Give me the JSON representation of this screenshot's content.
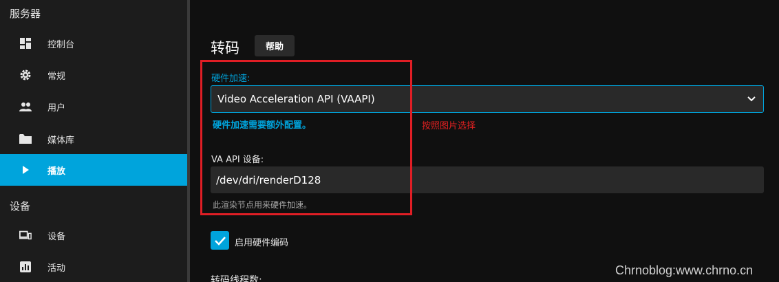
{
  "sidebar": {
    "section_server": "服务器",
    "section_devices": "设备",
    "items": [
      {
        "label": "控制台",
        "icon": "dashboard-icon"
      },
      {
        "label": "常规",
        "icon": "gear-icon"
      },
      {
        "label": "用户",
        "icon": "people-icon"
      },
      {
        "label": "媒体库",
        "icon": "folder-icon"
      },
      {
        "label": "播放",
        "icon": "play-icon",
        "active": true
      },
      {
        "label": "设备",
        "icon": "devices-icon"
      },
      {
        "label": "活动",
        "icon": "activity-chart-icon"
      }
    ]
  },
  "main": {
    "title": "转码",
    "help_button": "帮助",
    "hw_accel_label": "硬件加速:",
    "hw_accel_value": "Video Acceleration API (VAAPI)",
    "hw_accel_note": "硬件加速需要额外配置。",
    "annotation": "按照图片选择",
    "vaapi_device_label": "VA API 设备:",
    "vaapi_device_value": "/dev/dri/renderD128",
    "vaapi_device_hint": "此渲染节点用来硬件加速。",
    "hw_encoding_label": "启用硬件编码",
    "hw_encoding_checked": true,
    "transcode_threads_label": "转码线程数:"
  },
  "watermark": "Chrnoblog:www.chrno.cn",
  "colors": {
    "accent": "#00a4dc",
    "annotation": "#e01e25"
  }
}
